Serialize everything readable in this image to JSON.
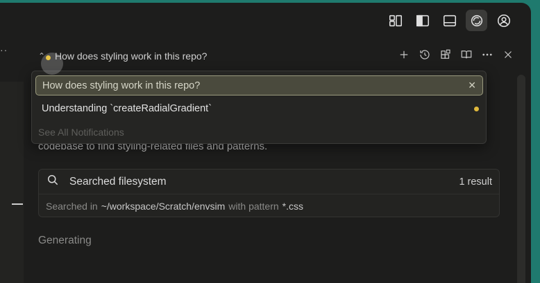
{
  "top_bar": {
    "icons": [
      "layout-icon",
      "sidebar-left-icon",
      "panel-bottom-icon",
      "chat-icon",
      "account-icon"
    ]
  },
  "panel": {
    "header_title": "How does styling work in this repo?",
    "actions": [
      "plus-icon",
      "history-icon",
      "extensions-icon",
      "book-icon",
      "more-icon",
      "close-icon"
    ]
  },
  "dropdown": {
    "selected": "How does styling work in this repo?",
    "item": "Understanding `createRadialGradient`",
    "footer": "See All Notifications"
  },
  "chat": {
    "background_text": "codebase to find styling-related files and patterns.",
    "result": {
      "title": "Searched filesystem",
      "count": "1 result",
      "prefix": "Searched in",
      "path": "~/workspace/Scratch/envsim",
      "middle": "with pattern",
      "pattern": "*.css"
    },
    "status": "Generating"
  },
  "colors": {
    "accent_dot": "#e0b93c",
    "backdrop": "#1f7a6e",
    "panel_bg": "#1d1d1c"
  }
}
